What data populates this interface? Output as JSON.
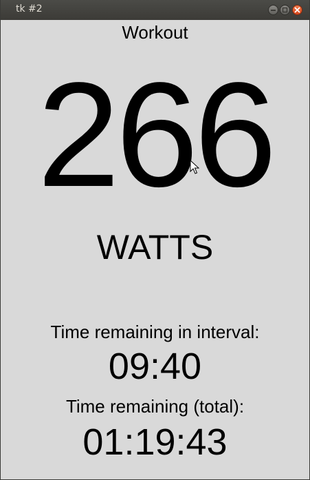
{
  "window": {
    "title": "tk #2",
    "buttons": [
      "minimize-icon",
      "maximize-icon",
      "close-icon"
    ]
  },
  "main": {
    "heading": "Workout",
    "power_value": "266",
    "power_unit": "WATTS",
    "interval_label": "Time remaining in interval:",
    "interval_value": "09:40",
    "total_label": "Time remaining (total):",
    "total_value": "01:19:43"
  },
  "colors": {
    "background": "#d9d9d9",
    "titlebar": "#3c3b37",
    "close_button": "#e0571f",
    "text": "#000000"
  }
}
